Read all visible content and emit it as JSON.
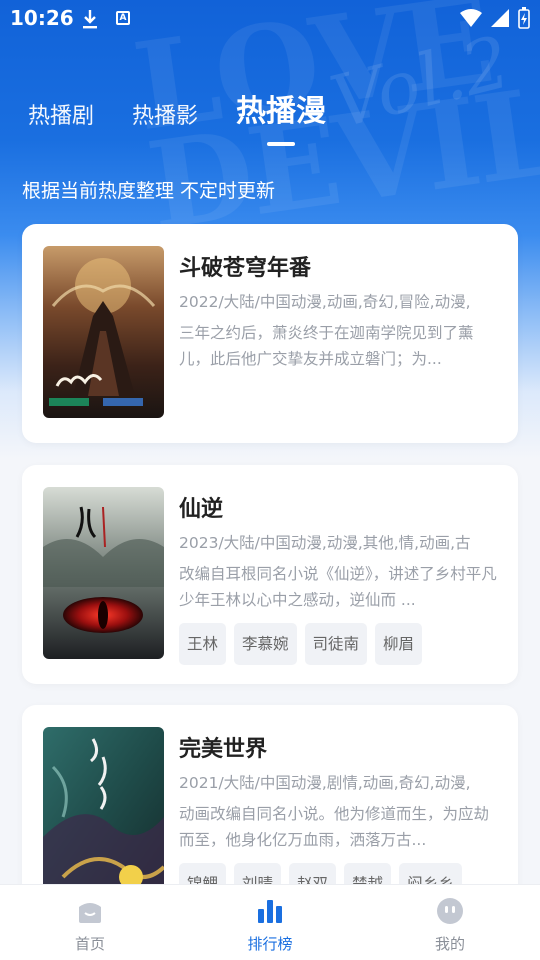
{
  "status_bar": {
    "time": "10:26",
    "download_icon": "download-icon",
    "a_badge": "A"
  },
  "header": {
    "tabs": [
      {
        "label": "热播剧",
        "active": false
      },
      {
        "label": "热播影",
        "active": false
      },
      {
        "label": "热播漫",
        "active": true
      }
    ],
    "subtitle": "根据当前热度整理 不定时更新"
  },
  "items": [
    {
      "title": "斗破苍穹年番",
      "meta": "2022/大陆/中国动漫,动画,奇幻,冒险,动漫,",
      "desc": "三年之约后，萧炎终于在迦南学院见到了薰儿，此后他广交挚友并成立磐门；为...",
      "tags": []
    },
    {
      "title": "仙逆",
      "meta": "2023/大陆/中国动漫,动漫,其他,情,动画,古",
      "desc": "改编自耳根同名小说《仙逆》，讲述了乡村平凡少年王林以心中之感动，逆仙而 ...",
      "tags": [
        "王林",
        "李慕婉",
        "司徒南",
        "柳眉"
      ]
    },
    {
      "title": "完美世界",
      "meta": "2021/大陆/中国动漫,剧情,动画,奇幻,动漫,",
      "desc": "动画改编自同名小说。他为修道而生，为应劫而至，他身化亿万血雨，洒落万古...",
      "tags": [
        "锦鲤",
        "刘晴",
        "赵双",
        "楚越",
        "闷乡乡"
      ]
    }
  ],
  "bottom_nav": [
    {
      "label": "首页",
      "icon": "home-icon",
      "active": false
    },
    {
      "label": "排行榜",
      "icon": "rank-chart-icon",
      "active": true
    },
    {
      "label": "我的",
      "icon": "profile-face-icon",
      "active": false
    }
  ],
  "colors": {
    "accent": "#1a6fe0",
    "hero_top": "#1162d8",
    "text_muted": "#9a9fa8"
  }
}
